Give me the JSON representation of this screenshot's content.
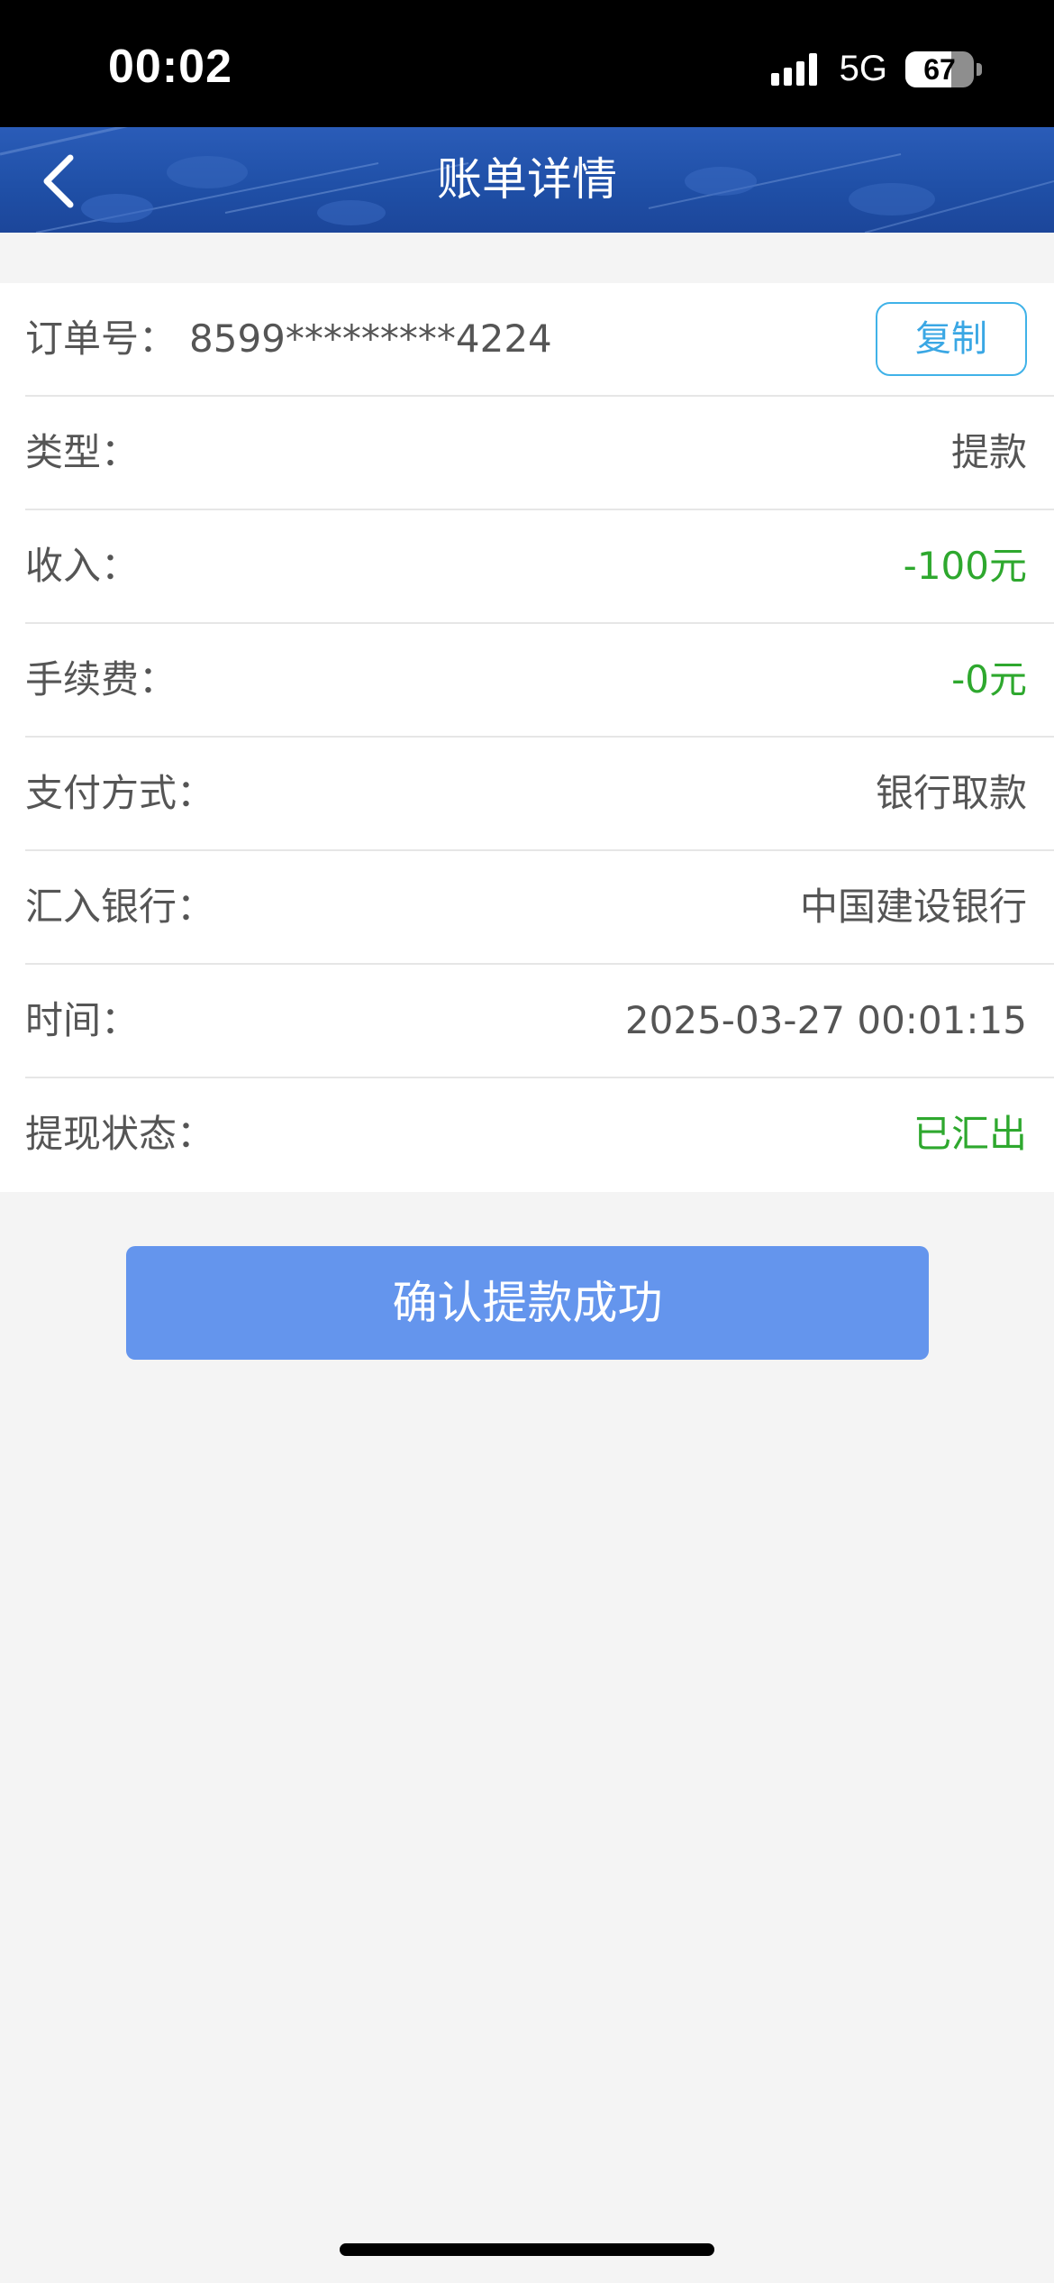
{
  "status_bar": {
    "time": "00:02",
    "network": "5G",
    "battery": "67",
    "battery_level": 0.67
  },
  "nav": {
    "title": "账单详情",
    "back_icon": "chevron-left-icon"
  },
  "order": {
    "label": "订单号：",
    "value": "8599*********4224",
    "copy_label": "复制"
  },
  "details": [
    {
      "label": "类型：",
      "value": "提款"
    },
    {
      "label": "收入：",
      "value": "-100元",
      "color": "#2ea82e"
    },
    {
      "label": "手续费：",
      "value": "-0元",
      "color": "#2ea82e"
    },
    {
      "label": "支付方式：",
      "value": "银行取款"
    },
    {
      "label": "汇入银行：",
      "value": "中国建设银行"
    },
    {
      "label": "时间：",
      "value": "2025-03-27 00:01:15"
    },
    {
      "label": "提现状态：",
      "value": "已汇出",
      "color": "#2ea82e"
    }
  ],
  "confirm_button": {
    "label": "确认提款成功"
  },
  "colors": {
    "nav_background": "#1f4fa6",
    "accent_blue": "#6495ed",
    "copy_border": "#40b2e8",
    "positive_green": "#2ea82e",
    "page_background": "#f4f4f4"
  }
}
